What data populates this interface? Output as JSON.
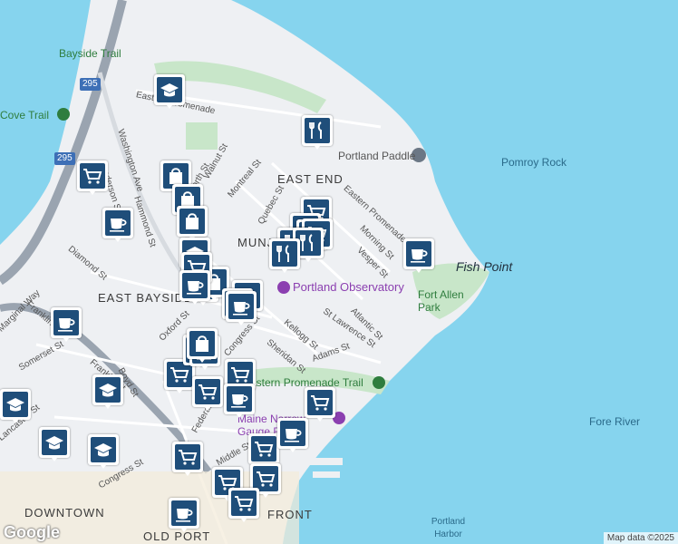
{
  "map": {
    "attribution": "Map data ©2025",
    "logo": "Google"
  },
  "labels": {
    "districts": [
      "EAST END",
      "MUNJOY",
      "EAST BAYSIDE",
      "DOWNTOWN",
      "OLD PORT",
      "FRONT"
    ],
    "water": [
      "Fore River",
      "Portland Harbor",
      "Pomroy Rock",
      "Fish Point"
    ],
    "pois": [
      "Portland Observatory",
      "Portland Paddle",
      "Maine Narrow Gauge RR"
    ],
    "parks": [
      "Fort Allen Park",
      "Eastern Promenade Trail",
      "Bayside Trail",
      "Cove Trail"
    ],
    "highway": "295",
    "streets": [
      "Eastern Promenade",
      "Washington Ave",
      "Anderson St",
      "Hammond St",
      "North St",
      "Walnut St",
      "Montreal St",
      "Quebec St",
      "Morning St",
      "Vesper St",
      "Diamond St",
      "Oxford St",
      "Congress St",
      "Kellogg St",
      "Sheridan St",
      "St Lawrence St",
      "Atlantic St",
      "Adams St",
      "Somerset St",
      "Franklin St",
      "Boyd St",
      "Lancaster St",
      "Federal St",
      "Middle St",
      "Marginal Way"
    ]
  },
  "markers": [
    {
      "type": "school-icon"
    },
    {
      "type": "restaurant-icon"
    },
    {
      "type": "shopping-cart-icon"
    },
    {
      "type": "shopping-bag-icon"
    },
    {
      "type": "coffee-icon"
    },
    {
      "type": "shopping-cart-icon"
    },
    {
      "type": "shopping-cart-icon"
    },
    {
      "type": "shopping-cart-icon"
    },
    {
      "type": "shopping-cart-icon"
    },
    {
      "type": "restaurant-icon"
    },
    {
      "type": "restaurant-icon"
    },
    {
      "type": "shopping-bag-icon"
    },
    {
      "type": "shopping-bag-icon"
    },
    {
      "type": "restaurant-icon"
    },
    {
      "type": "coffee-icon"
    },
    {
      "type": "coffee-icon"
    },
    {
      "type": "shopping-bag-icon"
    },
    {
      "type": "shopping-bag-icon"
    },
    {
      "type": "school-icon"
    },
    {
      "type": "shopping-cart-icon"
    },
    {
      "type": "coffee-icon"
    },
    {
      "type": "coffee-icon"
    },
    {
      "type": "coffee-icon"
    },
    {
      "type": "coffee-icon"
    },
    {
      "type": "school-icon"
    },
    {
      "type": "school-icon"
    },
    {
      "type": "shopping-cart-icon"
    },
    {
      "type": "shopping-cart-icon"
    },
    {
      "type": "shopping-cart-icon"
    },
    {
      "type": "shopping-cart-icon"
    },
    {
      "type": "coffee-icon"
    },
    {
      "type": "coffee-icon"
    },
    {
      "type": "shopping-cart-icon"
    }
  ],
  "colors": {
    "water": "#86d4ee",
    "land": "#eef0f3",
    "park": "#c8e6c9",
    "marker": "#1f4e7a",
    "highway": "#9aa4b0"
  }
}
